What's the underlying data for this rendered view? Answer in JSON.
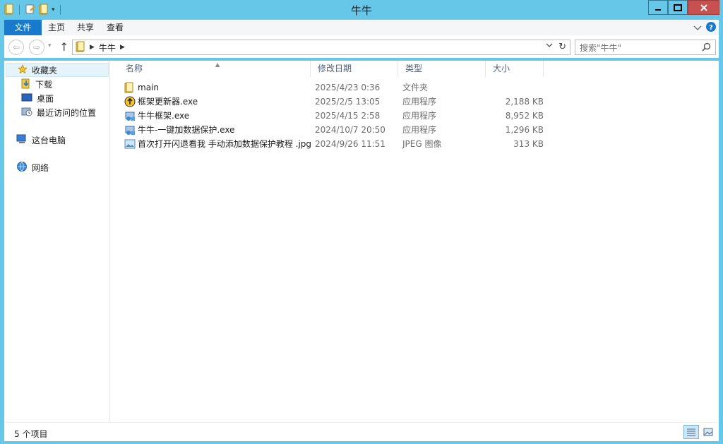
{
  "window": {
    "title": "牛牛"
  },
  "ribbon": {
    "tabs": [
      {
        "label": "文件"
      },
      {
        "label": "主页"
      },
      {
        "label": "共享"
      },
      {
        "label": "查看"
      }
    ]
  },
  "address": {
    "breadcrumb": "牛牛",
    "search_placeholder": "搜索\"牛牛\""
  },
  "sidebar": {
    "items": [
      {
        "label": "收藏夹",
        "icon": "star-icon"
      },
      {
        "label": "下载",
        "icon": "download-folder-icon"
      },
      {
        "label": "桌面",
        "icon": "desktop-icon"
      },
      {
        "label": "最近访问的位置",
        "icon": "recent-places-icon"
      },
      {
        "label": "这台电脑",
        "icon": "computer-icon"
      },
      {
        "label": "网络",
        "icon": "network-icon"
      }
    ]
  },
  "columns": {
    "name": "名称",
    "date": "修改日期",
    "type": "类型",
    "size": "大小"
  },
  "files": [
    {
      "name": "main",
      "date": "2025/4/23 0:36",
      "type": "文件夹",
      "size": "",
      "icon": "folder-icon"
    },
    {
      "name": "框架更新器.exe",
      "date": "2025/2/5 13:05",
      "type": "应用程序",
      "size": "2,188 KB",
      "icon": "updater-icon"
    },
    {
      "name": "牛牛框架.exe",
      "date": "2025/4/15 2:58",
      "type": "应用程序",
      "size": "8,952 KB",
      "icon": "app-icon"
    },
    {
      "name": "牛牛-一键加数据保护.exe",
      "date": "2024/10/7 20:50",
      "type": "应用程序",
      "size": "1,296 KB",
      "icon": "app-icon"
    },
    {
      "name": "首次打开闪退看我 手动添加数据保护教程 .jpg",
      "date": "2024/9/26 11:51",
      "type": "JPEG 图像",
      "size": "313 KB",
      "icon": "image-icon"
    }
  ],
  "status": {
    "text": "5 个项目"
  },
  "colors": {
    "frame": "#66c7e8",
    "file_tab": "#1979ca",
    "close": "#c75050",
    "selection": "#e5f3fb"
  }
}
